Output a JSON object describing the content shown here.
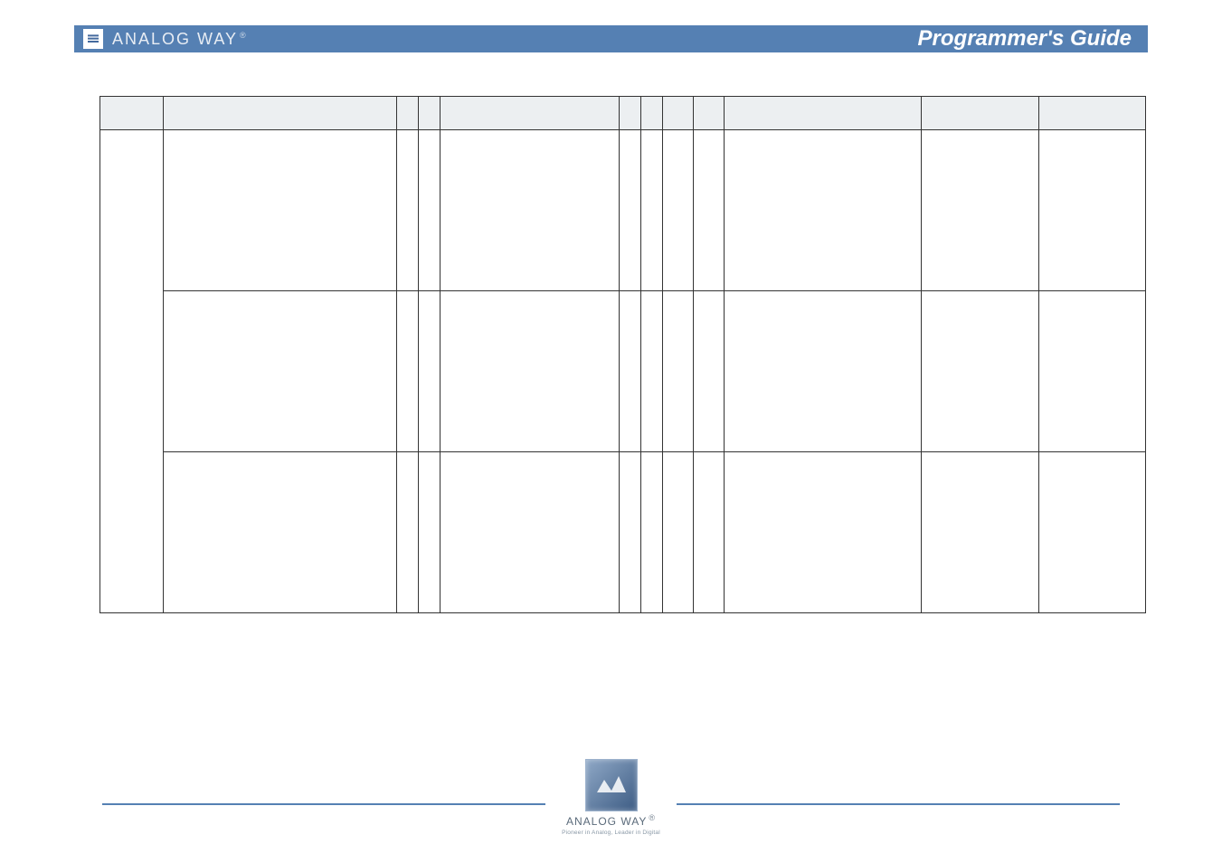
{
  "header": {
    "brand": "ANALOG WAY",
    "title": "Programmer's Guide"
  },
  "table": {
    "headers": [
      "",
      "",
      "",
      "",
      "",
      "",
      "",
      "",
      "",
      "",
      "",
      ""
    ]
  },
  "footer": {
    "brand": "ANALOG WAY",
    "tag": "Pioneer in Analog, Leader in Digital"
  }
}
